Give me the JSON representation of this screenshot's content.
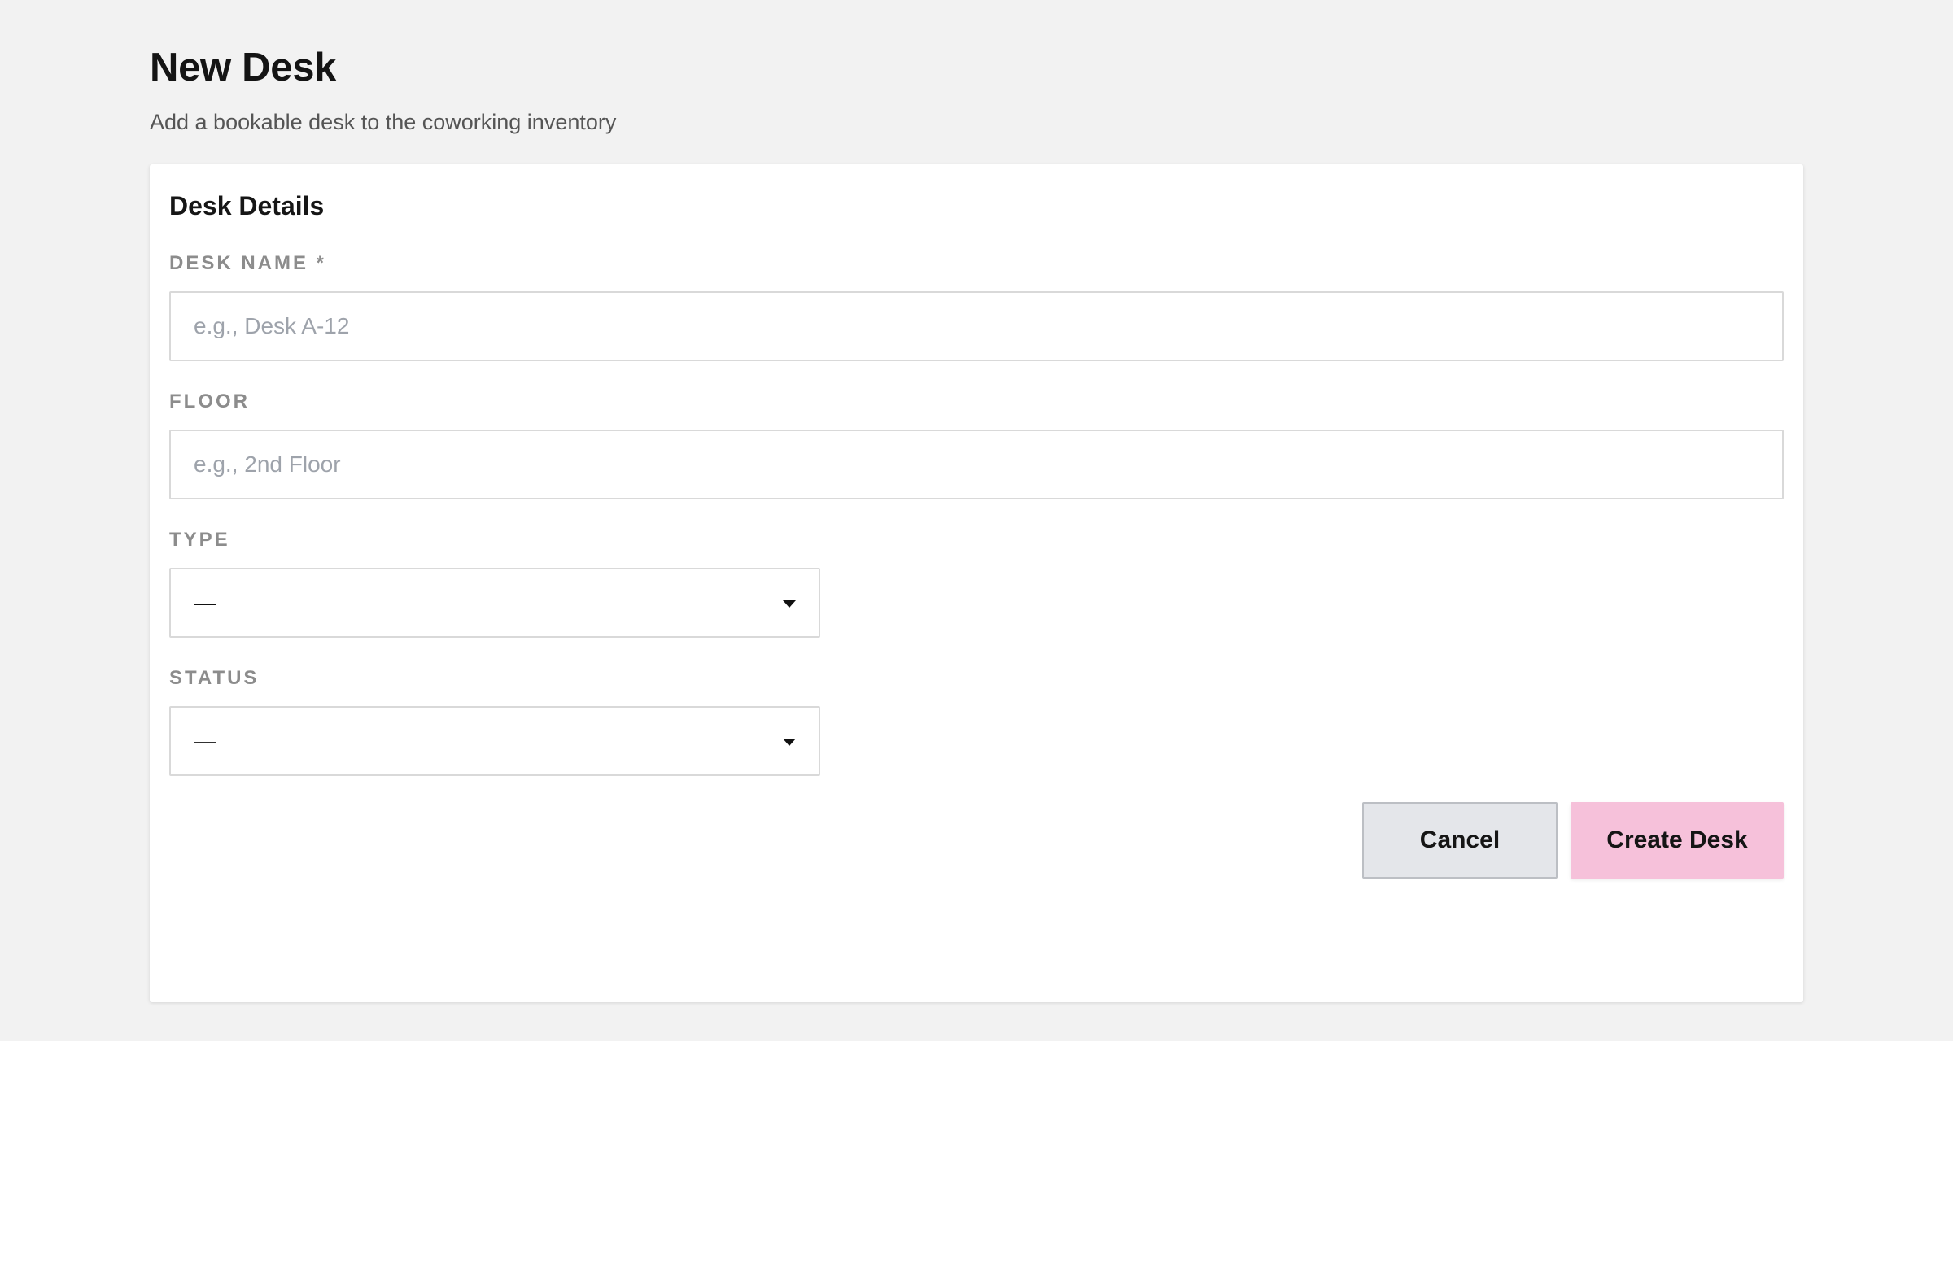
{
  "page": {
    "title": "New Desk",
    "subtitle": "Add a bookable desk to the coworking inventory"
  },
  "card": {
    "title": "Desk Details"
  },
  "form": {
    "desk_name": {
      "label": "DESK NAME *",
      "value": "",
      "placeholder": "e.g., Desk A-12"
    },
    "floor": {
      "label": "FLOOR",
      "value": "",
      "placeholder": "e.g., 2nd Floor"
    },
    "type": {
      "label": "TYPE",
      "selected": "—",
      "icon": "chevron-down-icon"
    },
    "status": {
      "label": "STATUS",
      "selected": "—",
      "icon": "chevron-down-icon"
    }
  },
  "actions": {
    "cancel_label": "Cancel",
    "create_label": "Create Desk"
  },
  "colors": {
    "page_background": "#f2f2f2",
    "card_background": "#ffffff",
    "primary_button": "#f6c1da",
    "secondary_button": "#e4e6ea",
    "label_text": "#8c8c8c"
  }
}
